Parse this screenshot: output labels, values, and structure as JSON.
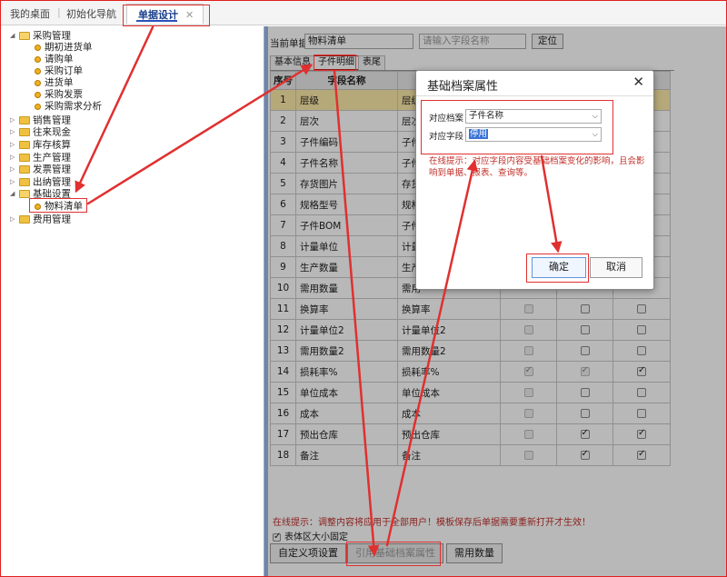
{
  "tabs": [
    {
      "label": "我的桌面"
    },
    {
      "label": "初始化导航"
    },
    {
      "label": "单据设计",
      "close": "✕"
    }
  ],
  "tree": {
    "groups": [
      {
        "label": "采购管理",
        "items": [
          "期初进货单",
          "请购单",
          "采购订单",
          "进货单",
          "采购发票",
          "采购需求分析"
        ]
      },
      {
        "label": "销售管理"
      },
      {
        "label": "往来现金"
      },
      {
        "label": "库存核算"
      },
      {
        "label": "生产管理"
      },
      {
        "label": "发票管理"
      },
      {
        "label": "出纳管理"
      },
      {
        "label": "基础设置",
        "items": [
          "物料清单"
        ]
      },
      {
        "label": "费用管理"
      }
    ]
  },
  "form": {
    "current_label": "当前单据",
    "current_value": "物料清单",
    "search_placeholder": "请输入字段名称",
    "locate_button": "定位",
    "subtabs": [
      "基本信息",
      "子件明细",
      "表尾"
    ]
  },
  "grid": {
    "headers": [
      "序号",
      "字段名称",
      "层级"
    ],
    "rows": [
      {
        "n": "1",
        "name": "层级",
        "alias": "层级"
      },
      {
        "n": "2",
        "name": "层次",
        "alias": "层次"
      },
      {
        "n": "3",
        "name": "子件编码",
        "alias": "子件"
      },
      {
        "n": "4",
        "name": "子件名称",
        "alias": "子件"
      },
      {
        "n": "5",
        "name": "存货图片",
        "alias": "存货"
      },
      {
        "n": "6",
        "name": "规格型号",
        "alias": "规格"
      },
      {
        "n": "7",
        "name": "子件BOM",
        "alias": "子件"
      },
      {
        "n": "8",
        "name": "计量单位",
        "alias": "计量"
      },
      {
        "n": "9",
        "name": "生产数量",
        "alias": "生产"
      },
      {
        "n": "10",
        "name": "需用数量",
        "alias": "需用"
      },
      {
        "n": "11",
        "name": "换算率",
        "alias": "换算率",
        "c": [
          0,
          0,
          0
        ]
      },
      {
        "n": "12",
        "name": "计量单位2",
        "alias": "计量单位2",
        "c": [
          0,
          0,
          0
        ]
      },
      {
        "n": "13",
        "name": "需用数量2",
        "alias": "需用数量2",
        "c": [
          0,
          0,
          0
        ]
      },
      {
        "n": "14",
        "name": "损耗率%",
        "alias": "损耗率%",
        "c": [
          1,
          1,
          1
        ]
      },
      {
        "n": "15",
        "name": "单位成本",
        "alias": "单位成本",
        "c": [
          0,
          0,
          0
        ]
      },
      {
        "n": "16",
        "name": "成本",
        "alias": "成本",
        "c": [
          0,
          0,
          0
        ]
      },
      {
        "n": "17",
        "name": "预出仓库",
        "alias": "预出仓库",
        "c": [
          0,
          1,
          1
        ]
      },
      {
        "n": "18",
        "name": "备注",
        "alias": "备注",
        "c": [
          0,
          1,
          1
        ]
      }
    ]
  },
  "bottom": {
    "tip": "在线提示：调整内容将应用于全部用户！模板保存后单据需要重新打开才生效！",
    "fixed_label": "表体区大小固定",
    "buttons": [
      "自定义项设置",
      "引用基础档案属性",
      "需用数量"
    ]
  },
  "dialog": {
    "title": "基础档案属性",
    "close": "✕",
    "archive_label": "对应档案",
    "archive_value": "子件名称",
    "field_label": "对应字段",
    "field_value": "停用",
    "tip": "在线提示：对应字段内容受基础档案变化的影响，且会影响到单据、报表、查询等。",
    "ok": "确定",
    "cancel": "取消"
  },
  "colors": {
    "annotation": "#e03030",
    "selected_row": "#fdeaa8",
    "tip_text": "#c0302a",
    "active_tab": "#1a3e8c"
  }
}
